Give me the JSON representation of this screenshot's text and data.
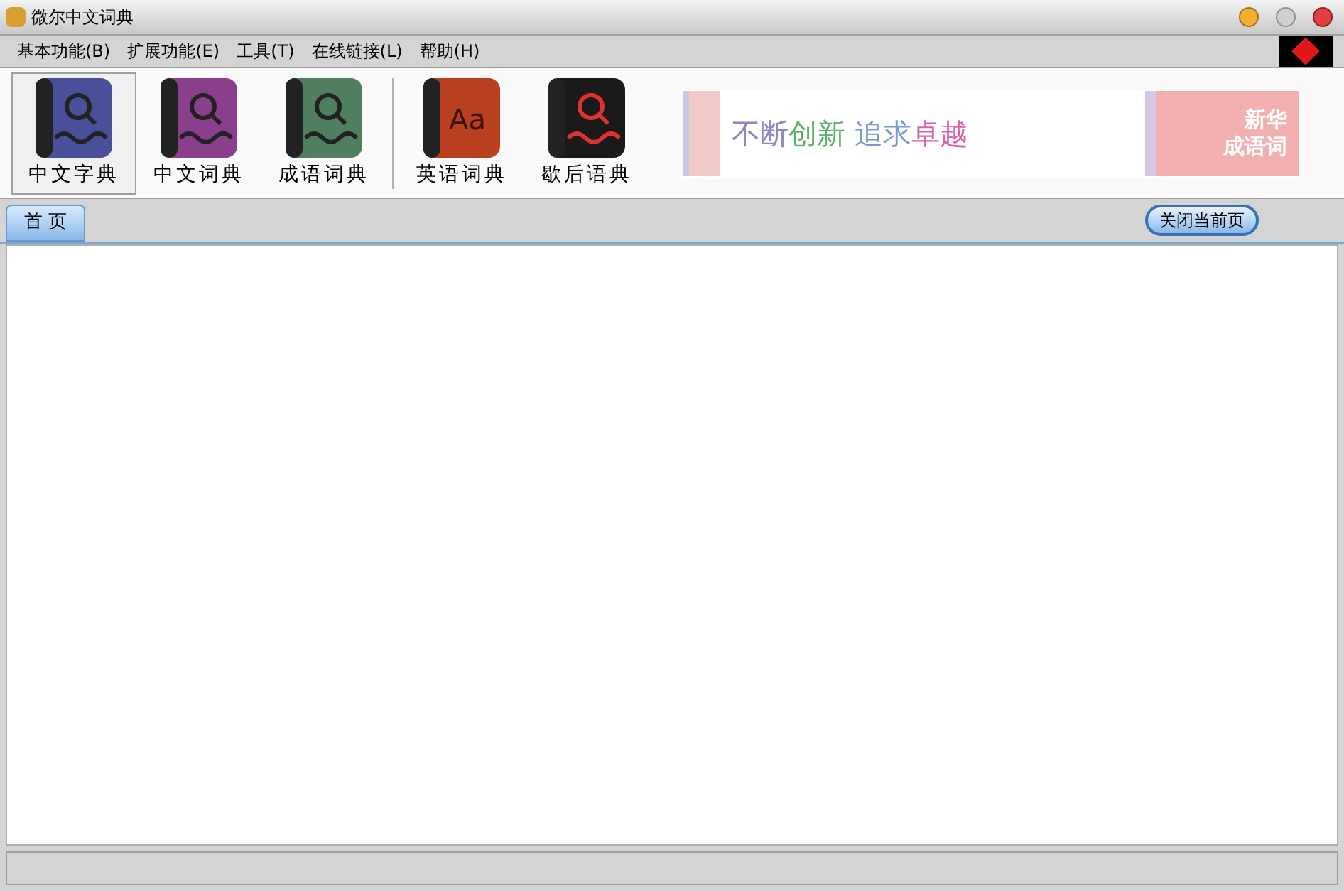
{
  "window": {
    "title": "微尔中文词典"
  },
  "menu": [
    "基本功能(B)",
    "扩展功能(E)",
    "工具(T)",
    "在线链接(L)",
    "帮助(H)"
  ],
  "toolbar": [
    {
      "label": "中文字典",
      "selected": true,
      "kind": "search",
      "color": "#4a4f9a"
    },
    {
      "label": "中文词典",
      "selected": false,
      "kind": "search",
      "color": "#8a3f8c"
    },
    {
      "label": "成语词典",
      "selected": false,
      "kind": "search",
      "color": "#4f7f5f"
    },
    {
      "label": "英语词典",
      "selected": false,
      "kind": "letters",
      "color": "#b8401f",
      "icon_text": "Aa"
    },
    {
      "label": "歇后语典",
      "selected": false,
      "kind": "search",
      "color": "#1a1a1a"
    }
  ],
  "banner": {
    "slogan": [
      {
        "text": "不断",
        "color": "#8a8cc0"
      },
      {
        "text": "创新",
        "color": "#5fae6a"
      },
      {
        "text": " 追求",
        "color": "#7a9ad0"
      },
      {
        "text": "卓越",
        "color": "#d860a8"
      }
    ],
    "ad_text": [
      "新华",
      "成语词"
    ]
  },
  "tabs": [
    {
      "label": "首 页",
      "selected": true
    }
  ],
  "close_page_button": "关闭当前页"
}
